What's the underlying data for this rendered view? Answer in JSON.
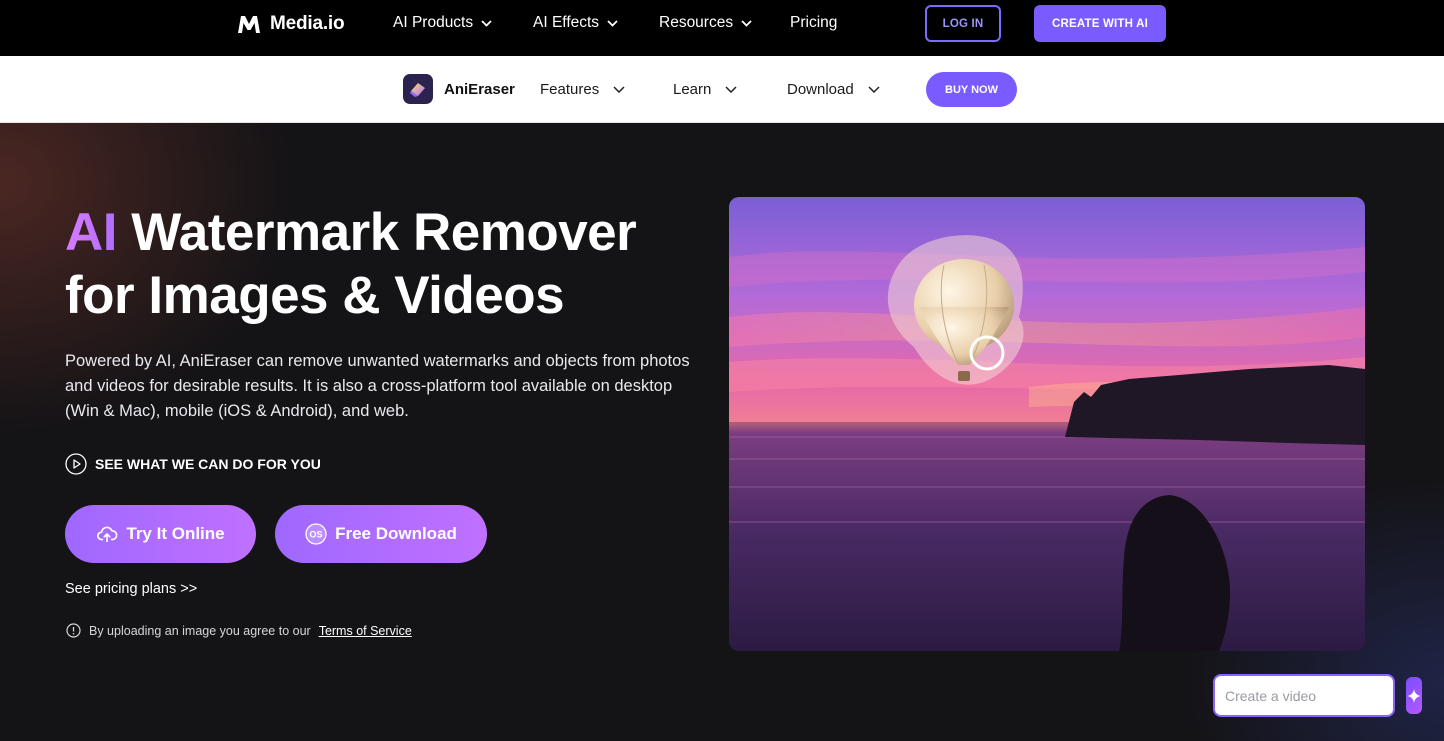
{
  "topnav": {
    "brand": "Media.io",
    "items": [
      {
        "label": "AI Products"
      },
      {
        "label": "AI Effects"
      },
      {
        "label": "Resources"
      },
      {
        "label": "Pricing"
      }
    ],
    "login": "LOG IN",
    "create": "CREATE WITH AI"
  },
  "subnav": {
    "product": "AniEraser",
    "items": [
      {
        "label": "Features"
      },
      {
        "label": "Learn"
      },
      {
        "label": "Download"
      }
    ],
    "buy": "BUY NOW"
  },
  "hero": {
    "title_accent": "AI",
    "title_rest": "Watermark Remover",
    "title_line2": "for Images & Videos",
    "description": "Powered by AI, AniEraser can remove unwanted watermarks and objects from photos and videos for desirable results. It is also a cross-platform tool available on desktop (Win & Mac), mobile (iOS & Android), and web.",
    "see_what": "SEE WHAT WE CAN DO FOR YOU",
    "try_online": "Try It Online",
    "free_download": "Free Download",
    "free_download_icon_text": "OS",
    "pricing_link": "See pricing plans >>",
    "terms_prefix": "By uploading an image you agree to our",
    "terms_link": "Terms of Service"
  },
  "widget": {
    "placeholder": "Create a video"
  },
  "colors": {
    "accent": "#7a5bff",
    "gradient_start": "#9f68ff",
    "gradient_end": "#c070ff"
  }
}
